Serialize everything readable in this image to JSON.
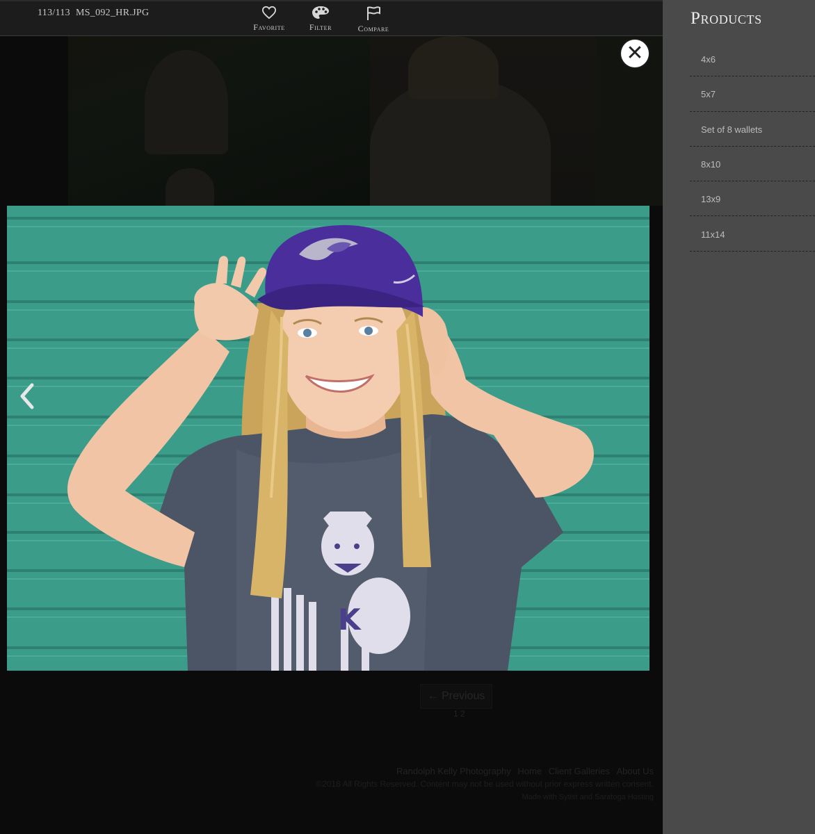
{
  "toolbar": {
    "counter": "113/113",
    "filename": "MS_092_HR.JPG",
    "favorite_label": "Favorite",
    "filter_label": "Filter",
    "compare_label": "Compare"
  },
  "icons": {
    "favorite": "heart-icon",
    "filter": "palette-icon",
    "compare": "flag-icon",
    "close": "close-icon",
    "previous": "chevron-left-icon"
  },
  "close_glyph": "✕",
  "sidebar": {
    "title": "Products",
    "products": [
      "4x6",
      "5x7",
      "Set of 8 wallets",
      "8x10",
      "13x9",
      "11x14"
    ]
  },
  "background_page": {
    "pager_label": "← Previous",
    "page_number": "1 2",
    "footer_links": [
      "Randolph Kelly Photography",
      "Home",
      "Client Galleries",
      "About Us"
    ],
    "copyright": "©2018 All Rights Reserved. Content may not be used without prior express written consent.",
    "credits": "Made with Sytist and Saratoga Hosting"
  },
  "colors": {
    "sidebar_bg": "#4a4a4a",
    "toolbar_bg": "#1c1c1c",
    "wall_teal": "#3b9c8a",
    "cap_purple": "#4a2f9c"
  }
}
